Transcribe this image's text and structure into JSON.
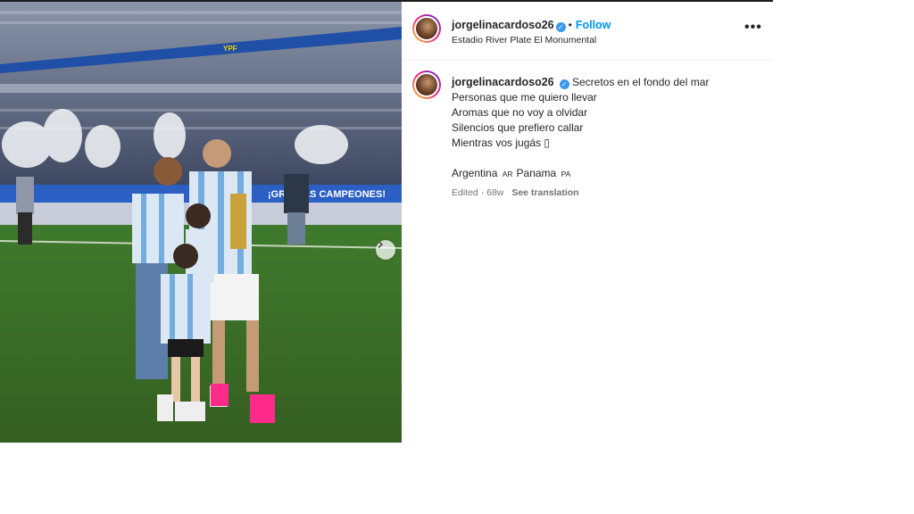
{
  "post": {
    "username": "jorgelinacardoso26",
    "verified_mark": "✓",
    "dot": "•",
    "follow_label": "Follow",
    "location": "Estadio River Plate El Monumental",
    "more_label": "•••",
    "caption_first": "Secretos en el fondo del mar",
    "caption_lines": [
      "Personas que me quiero llevar",
      "Aromas que no voy a olvidar",
      "Silencios que prefiero callar",
      "Mientras vos jugás ▯"
    ],
    "tags_line": {
      "country1": "Argentina",
      "flag1": "AR",
      "country2": "Panama",
      "flag2": "PA"
    },
    "edited_label": "Edited",
    "time_ago": "68w",
    "meta_separator": "·",
    "see_translation": "See translation"
  },
  "photo": {
    "banner_text": "¡GRACIAS CAMPEONES!",
    "ad_text": "YPF",
    "next_icon": "chevron-right-icon"
  },
  "colors": {
    "follow": "#0095f6",
    "verified": "#3897f0",
    "pitch": "#3f7a2c",
    "stands": "#5f6f88"
  }
}
